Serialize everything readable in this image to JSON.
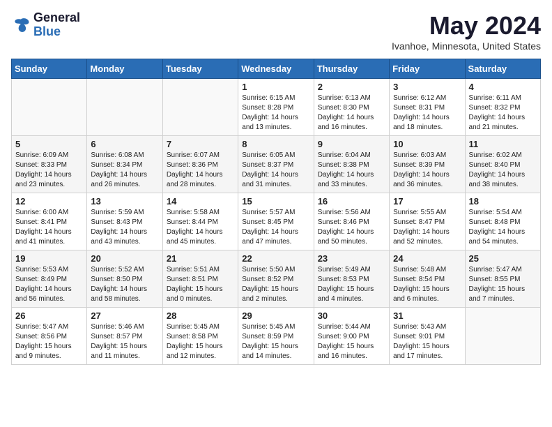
{
  "header": {
    "logo_general": "General",
    "logo_blue": "Blue",
    "month_title": "May 2024",
    "location": "Ivanhoe, Minnesota, United States"
  },
  "days_of_week": [
    "Sunday",
    "Monday",
    "Tuesday",
    "Wednesday",
    "Thursday",
    "Friday",
    "Saturday"
  ],
  "weeks": [
    [
      {
        "day": "",
        "info": ""
      },
      {
        "day": "",
        "info": ""
      },
      {
        "day": "",
        "info": ""
      },
      {
        "day": "1",
        "info": "Sunrise: 6:15 AM\nSunset: 8:28 PM\nDaylight: 14 hours and 13 minutes."
      },
      {
        "day": "2",
        "info": "Sunrise: 6:13 AM\nSunset: 8:30 PM\nDaylight: 14 hours and 16 minutes."
      },
      {
        "day": "3",
        "info": "Sunrise: 6:12 AM\nSunset: 8:31 PM\nDaylight: 14 hours and 18 minutes."
      },
      {
        "day": "4",
        "info": "Sunrise: 6:11 AM\nSunset: 8:32 PM\nDaylight: 14 hours and 21 minutes."
      }
    ],
    [
      {
        "day": "5",
        "info": "Sunrise: 6:09 AM\nSunset: 8:33 PM\nDaylight: 14 hours and 23 minutes."
      },
      {
        "day": "6",
        "info": "Sunrise: 6:08 AM\nSunset: 8:34 PM\nDaylight: 14 hours and 26 minutes."
      },
      {
        "day": "7",
        "info": "Sunrise: 6:07 AM\nSunset: 8:36 PM\nDaylight: 14 hours and 28 minutes."
      },
      {
        "day": "8",
        "info": "Sunrise: 6:05 AM\nSunset: 8:37 PM\nDaylight: 14 hours and 31 minutes."
      },
      {
        "day": "9",
        "info": "Sunrise: 6:04 AM\nSunset: 8:38 PM\nDaylight: 14 hours and 33 minutes."
      },
      {
        "day": "10",
        "info": "Sunrise: 6:03 AM\nSunset: 8:39 PM\nDaylight: 14 hours and 36 minutes."
      },
      {
        "day": "11",
        "info": "Sunrise: 6:02 AM\nSunset: 8:40 PM\nDaylight: 14 hours and 38 minutes."
      }
    ],
    [
      {
        "day": "12",
        "info": "Sunrise: 6:00 AM\nSunset: 8:41 PM\nDaylight: 14 hours and 41 minutes."
      },
      {
        "day": "13",
        "info": "Sunrise: 5:59 AM\nSunset: 8:43 PM\nDaylight: 14 hours and 43 minutes."
      },
      {
        "day": "14",
        "info": "Sunrise: 5:58 AM\nSunset: 8:44 PM\nDaylight: 14 hours and 45 minutes."
      },
      {
        "day": "15",
        "info": "Sunrise: 5:57 AM\nSunset: 8:45 PM\nDaylight: 14 hours and 47 minutes."
      },
      {
        "day": "16",
        "info": "Sunrise: 5:56 AM\nSunset: 8:46 PM\nDaylight: 14 hours and 50 minutes."
      },
      {
        "day": "17",
        "info": "Sunrise: 5:55 AM\nSunset: 8:47 PM\nDaylight: 14 hours and 52 minutes."
      },
      {
        "day": "18",
        "info": "Sunrise: 5:54 AM\nSunset: 8:48 PM\nDaylight: 14 hours and 54 minutes."
      }
    ],
    [
      {
        "day": "19",
        "info": "Sunrise: 5:53 AM\nSunset: 8:49 PM\nDaylight: 14 hours and 56 minutes."
      },
      {
        "day": "20",
        "info": "Sunrise: 5:52 AM\nSunset: 8:50 PM\nDaylight: 14 hours and 58 minutes."
      },
      {
        "day": "21",
        "info": "Sunrise: 5:51 AM\nSunset: 8:51 PM\nDaylight: 15 hours and 0 minutes."
      },
      {
        "day": "22",
        "info": "Sunrise: 5:50 AM\nSunset: 8:52 PM\nDaylight: 15 hours and 2 minutes."
      },
      {
        "day": "23",
        "info": "Sunrise: 5:49 AM\nSunset: 8:53 PM\nDaylight: 15 hours and 4 minutes."
      },
      {
        "day": "24",
        "info": "Sunrise: 5:48 AM\nSunset: 8:54 PM\nDaylight: 15 hours and 6 minutes."
      },
      {
        "day": "25",
        "info": "Sunrise: 5:47 AM\nSunset: 8:55 PM\nDaylight: 15 hours and 7 minutes."
      }
    ],
    [
      {
        "day": "26",
        "info": "Sunrise: 5:47 AM\nSunset: 8:56 PM\nDaylight: 15 hours and 9 minutes."
      },
      {
        "day": "27",
        "info": "Sunrise: 5:46 AM\nSunset: 8:57 PM\nDaylight: 15 hours and 11 minutes."
      },
      {
        "day": "28",
        "info": "Sunrise: 5:45 AM\nSunset: 8:58 PM\nDaylight: 15 hours and 12 minutes."
      },
      {
        "day": "29",
        "info": "Sunrise: 5:45 AM\nSunset: 8:59 PM\nDaylight: 15 hours and 14 minutes."
      },
      {
        "day": "30",
        "info": "Sunrise: 5:44 AM\nSunset: 9:00 PM\nDaylight: 15 hours and 16 minutes."
      },
      {
        "day": "31",
        "info": "Sunrise: 5:43 AM\nSunset: 9:01 PM\nDaylight: 15 hours and 17 minutes."
      },
      {
        "day": "",
        "info": ""
      }
    ]
  ]
}
